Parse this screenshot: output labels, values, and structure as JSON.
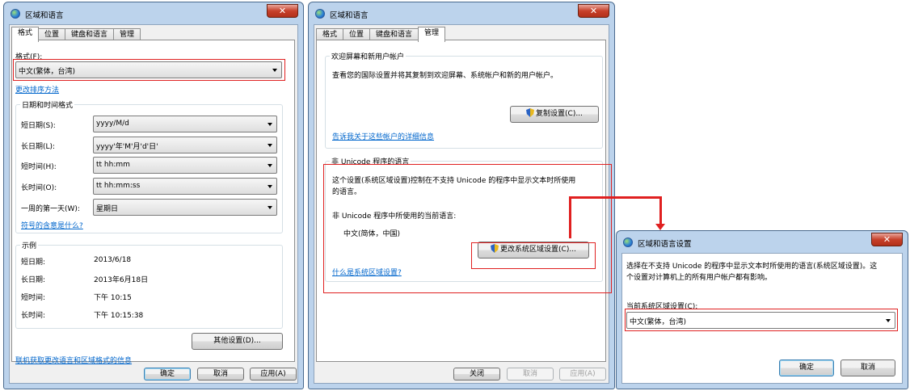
{
  "win1": {
    "title": "区域和语言",
    "close": "✕",
    "tabs": [
      "格式",
      "位置",
      "键盘和语言",
      "管理"
    ],
    "format_label": "格式(F):",
    "format_value": "中文(繁体，台湾)",
    "sort_link": "更改排序方法",
    "datetime_group": "日期和时间格式",
    "rows": [
      {
        "label": "短日期(S):",
        "value": "yyyy/M/d"
      },
      {
        "label": "长日期(L):",
        "value": "yyyy'年'M'月'd'日'"
      },
      {
        "label": "短时间(H):",
        "value": "tt hh:mm"
      },
      {
        "label": "长时间(O):",
        "value": "tt hh:mm:ss"
      },
      {
        "label": "一周的第一天(W):",
        "value": "星期日"
      }
    ],
    "symbols_link": "符号的含意是什么?",
    "example_group": "示例",
    "examples": [
      {
        "label": "短日期:",
        "value": "2013/6/18"
      },
      {
        "label": "长日期:",
        "value": "2013年6月18日"
      },
      {
        "label": "短时间:",
        "value": "下午 10:15"
      },
      {
        "label": "长时间:",
        "value": "下午 10:15:38"
      }
    ],
    "other_button": "其他设置(D)...",
    "online_link": "联机获取更改语言和区域格式的信息",
    "ok": "确定",
    "cancel": "取消",
    "apply": "应用(A)"
  },
  "win2": {
    "title": "区域和语言",
    "close": "✕",
    "tabs": [
      "格式",
      "位置",
      "键盘和语言",
      "管理"
    ],
    "welcome_group": "欢迎屏幕和新用户帐户",
    "welcome_text": "查看您的国际设置并将其复制到欢迎屏幕、系统帐户和新的用户帐户。",
    "copy_button": "复制设置(C)...",
    "accounts_link": "告诉我关于这些帐户的详细信息",
    "nonunicode_group": "非 Unicode 程序的语言",
    "nonunicode_text1": "这个设置(系统区域设置)控制在不支持 Unicode 的程序中显示文本时所使用",
    "nonunicode_text2": "的语言。",
    "current_label": "非 Unicode 程序中所使用的当前语言:",
    "current_value": "中文(简体，中国)",
    "change_button": "更改系统区域设置(C)...",
    "locale_link": "什么是系统区域设置?",
    "close_btn": "关闭",
    "cancel": "取消",
    "apply": "应用(A)"
  },
  "win3": {
    "title": "区域和语言设置",
    "close": "✕",
    "desc1": "选择在不支持 Unicode 的程序中显示文本时所使用的语言(系统区域设置)。这",
    "desc2": "个设置对计算机上的所有用户帐户都有影响。",
    "current_label": "当前系统区域设置(C):",
    "current_value": "中文(繁体，台湾)",
    "ok": "确定",
    "cancel": "取消"
  }
}
